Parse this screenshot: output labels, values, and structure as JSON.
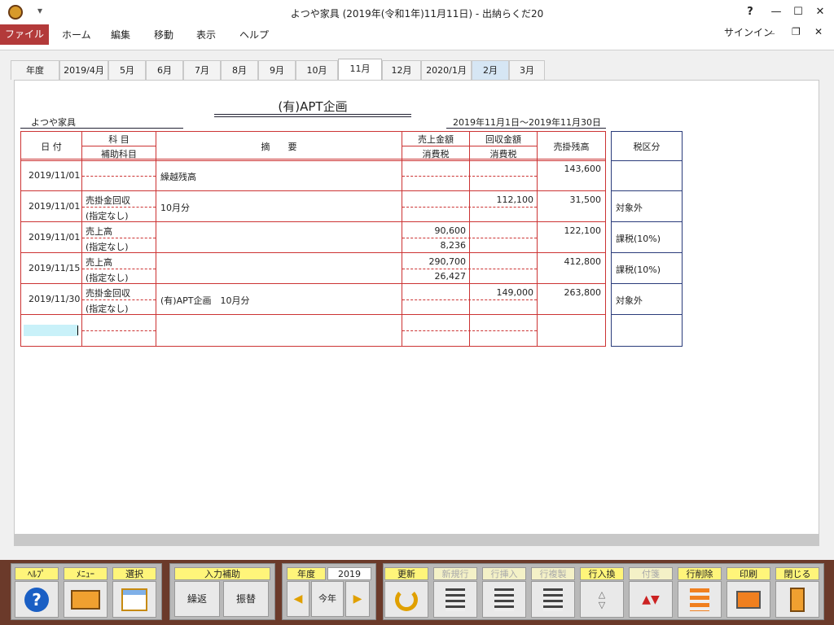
{
  "window": {
    "title": "よつや家具 (2019年(令和1年)11月11日) - 出納らくだ20",
    "help": "?",
    "minimize": "—",
    "maximize": "☐",
    "close": "✕",
    "qat_arrow": "▾"
  },
  "menu": {
    "file": "ファイル",
    "home": "ホーム",
    "edit": "編集",
    "move": "移動",
    "view": "表示",
    "help": "ヘルプ",
    "signin": "サインイン",
    "restore": "❐",
    "close": "✕",
    "ribbon_min": "_"
  },
  "tabs": [
    "年度",
    "2019/4月",
    "5月",
    "6月",
    "7月",
    "8月",
    "9月",
    "10月",
    "11月",
    "12月",
    "2020/1月",
    "2月",
    "3月"
  ],
  "doc": {
    "title": "(有)APT企画",
    "company": "よつや家具",
    "period": "2019年11月1日～2019年11月30日"
  },
  "headers": {
    "date": "日 付",
    "account": "科 目",
    "sub_account": "補助科目",
    "summary": "摘　　要",
    "sales": "売上金額",
    "sales_tax": "消費税",
    "collected": "回収金額",
    "collected_tax": "消費税",
    "balance": "売掛残高",
    "tax_class": "税区分"
  },
  "rows": [
    {
      "date": "2019/11/01",
      "account": "",
      "sub": "",
      "summary": "繰越残高",
      "sales": "",
      "tax": "",
      "collected": "",
      "balance": "143,600",
      "tax_class": ""
    },
    {
      "date": "2019/11/01",
      "account": "売掛金回収",
      "sub": "(指定なし)",
      "summary": "10月分",
      "sales": "",
      "tax": "",
      "collected": "112,100",
      "balance": "31,500",
      "tax_class": "対象外"
    },
    {
      "date": "2019/11/01",
      "account": "売上高",
      "sub": "(指定なし)",
      "summary": "",
      "sales": "90,600",
      "tax": "8,236",
      "collected": "",
      "balance": "122,100",
      "tax_class": "課税(10%)"
    },
    {
      "date": "2019/11/15",
      "account": "売上高",
      "sub": "(指定なし)",
      "summary": "",
      "sales": "290,700",
      "tax": "26,427",
      "collected": "",
      "balance": "412,800",
      "tax_class": "課税(10%)"
    },
    {
      "date": "2019/11/30",
      "account": "売掛金回収",
      "sub": "(指定なし)",
      "summary": "(有)APT企画　10月分",
      "sales": "",
      "tax": "",
      "collected": "149,000",
      "balance": "263,800",
      "tax_class": "対象外"
    }
  ],
  "toolbar": {
    "help": "ﾍﾙﾌﾟ",
    "menu": "ﾒﾆｭｰ",
    "select": "選択",
    "input_assist": "入力補助",
    "carry": "繰返",
    "transfer": "振替",
    "year_label": "年度",
    "year_value": "2019",
    "this_year": "今年",
    "prev": "◀",
    "next": "▶",
    "update": "更新",
    "new_row": "新規行",
    "insert_row": "行挿入",
    "copy_row": "行複製",
    "swap_row": "行入換",
    "sticky": "付箋",
    "delete_row": "行削除",
    "print": "印刷",
    "close": "閉じる"
  },
  "colors": {
    "accent": "#b33a3a",
    "grid": "#cc3333",
    "tax_grid": "#2a3b7a",
    "label_yellow": "#fff57a",
    "entry_highlight": "#c9f1f9"
  }
}
